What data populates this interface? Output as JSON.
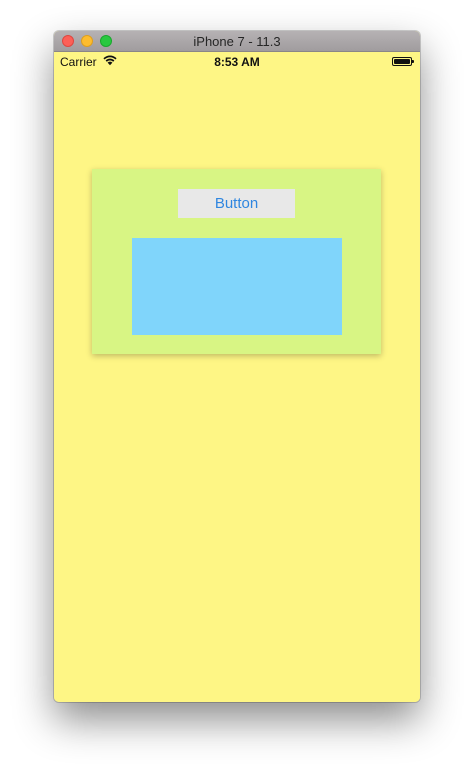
{
  "window": {
    "title": "iPhone 7 - 11.3"
  },
  "status_bar": {
    "carrier": "Carrier",
    "time": "8:53 AM",
    "battery_level": 1.0,
    "wifi_icon": "wifi-icon",
    "battery_icon": "battery-icon"
  },
  "content": {
    "button_label": "Button"
  },
  "colors": {
    "screen_background": "#fef685",
    "panel_background": "#d8f584",
    "box_background": "#80d5fb",
    "button_background": "#e8e8e8",
    "button_text": "#2f86e0"
  }
}
